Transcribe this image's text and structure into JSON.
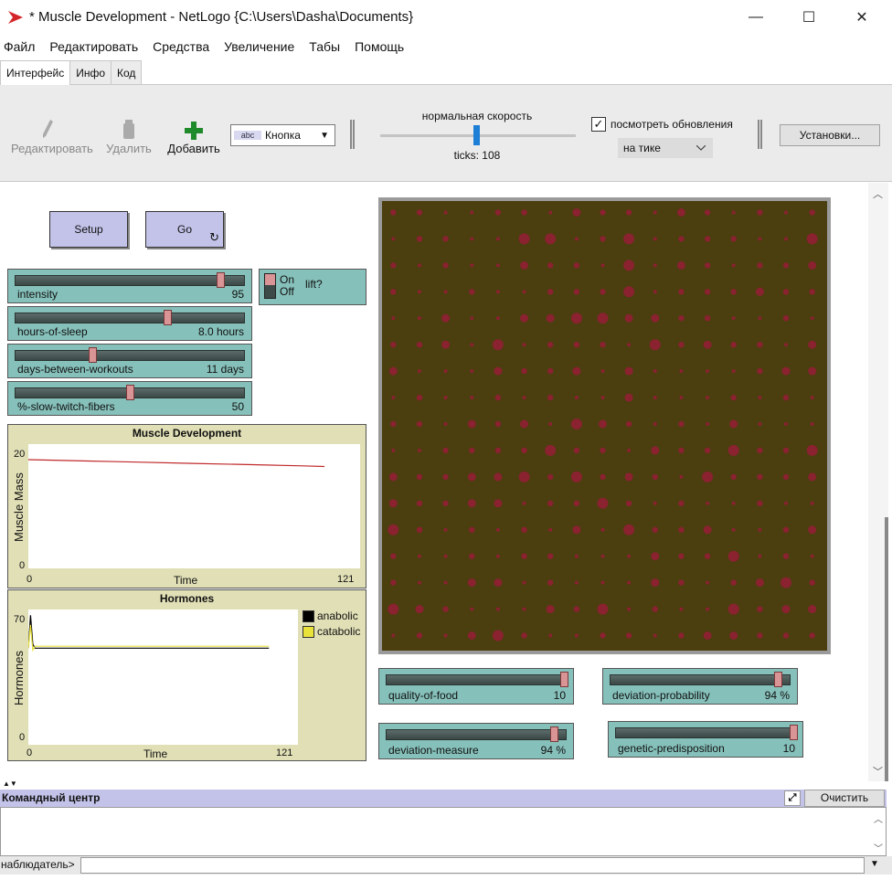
{
  "window": {
    "title": "* Muscle Development - NetLogo {C:\\Users\\Dasha\\Documents}",
    "minimize": "—",
    "maximize": "☐",
    "close": "✕"
  },
  "menu": [
    "Файл",
    "Редактировать",
    "Средства",
    "Увеличение",
    "Табы",
    "Помощь"
  ],
  "tabs": [
    "Интерфейс",
    "Инфо",
    "Код"
  ],
  "toolbar": {
    "edit_label": "Редактировать",
    "delete_label": "Удалить",
    "add_label": "Добавить",
    "widget_type": "Кнопка",
    "widget_icon_text": "abc",
    "speed_label": "нормальная скорость",
    "speed_fraction": 0.5,
    "ticks_text": "ticks: 108",
    "view_updates_label": "посмотреть обновления",
    "view_updates_checked": true,
    "check_mark": "✓",
    "update_mode": "на тике",
    "settings_label": "Установки..."
  },
  "buttons": {
    "setup": "Setup",
    "go": "Go"
  },
  "switch": {
    "on": "On",
    "off": "Off",
    "name": "lift?",
    "state": "off"
  },
  "sliders": {
    "intensity": {
      "name": "intensity",
      "value": "95",
      "fraction": 0.95
    },
    "sleep": {
      "name": "hours-of-sleep",
      "value": "8.0 hours",
      "fraction": 0.67
    },
    "days": {
      "name": "days-between-workouts",
      "value": "11 days",
      "fraction": 0.33
    },
    "slow": {
      "name": "%-slow-twitch-fibers",
      "value": "50",
      "fraction": 0.5
    },
    "food": {
      "name": "quality-of-food",
      "value": "10",
      "fraction": 1.0
    },
    "devprob": {
      "name": "deviation-probability",
      "value": "94 %",
      "fraction": 0.94
    },
    "devmeasure": {
      "name": "deviation-measure",
      "value": "94 %",
      "fraction": 0.94
    },
    "genetic": {
      "name": "genetic-predisposition",
      "value": "10",
      "fraction": 1.0
    }
  },
  "plots": {
    "muscle": {
      "title": "Muscle Development",
      "ylabel": "Muscle Mass",
      "xlabel": "Time",
      "ymax": "20",
      "ymin": "0",
      "xmin": "0",
      "xmax": "121"
    },
    "hormones": {
      "title": "Hormones",
      "ylabel": "Hormones",
      "xlabel": "Time",
      "ymax": "70",
      "ymin": "0",
      "xmin": "0",
      "xmax": "121",
      "legend": [
        {
          "name": "anabolic",
          "color": "#000000"
        },
        {
          "name": "catabolic",
          "color": "#e8e23a"
        }
      ]
    }
  },
  "chart_data": [
    {
      "type": "line",
      "title": "Muscle Development",
      "xlabel": "Time",
      "ylabel": "Muscle Mass",
      "xlim": [
        0,
        121
      ],
      "ylim": [
        0,
        20
      ],
      "series": [
        {
          "color": "#c0282a",
          "x": [
            0,
            20,
            40,
            60,
            80,
            100,
            108
          ],
          "y": [
            17.5,
            17.3,
            17.1,
            16.9,
            16.7,
            16.5,
            16.4
          ]
        }
      ]
    },
    {
      "type": "line",
      "title": "Hormones",
      "xlabel": "Time",
      "ylabel": "Hormones",
      "xlim": [
        0,
        121
      ],
      "ylim": [
        0,
        70
      ],
      "legend": "right",
      "series": [
        {
          "name": "anabolic",
          "color": "#000000",
          "x": [
            0,
            1,
            2,
            3,
            4,
            108
          ],
          "y": [
            50,
            67,
            52,
            50,
            50,
            50
          ]
        },
        {
          "name": "catabolic",
          "color": "#e8e23a",
          "x": [
            0,
            1,
            2,
            3,
            108
          ],
          "y": [
            50,
            62,
            49,
            51,
            51
          ]
        }
      ]
    }
  ],
  "command_center": {
    "title": "Командный центр",
    "clear_label": "Очистить",
    "prompt": "наблюдатель>",
    "input_value": ""
  },
  "colors": {
    "button_bg": "#c3c3ea",
    "slider_bg": "#86c0ba",
    "plot_bg": "#e0dfb6",
    "world_bg": "#4b3e0f",
    "turtle": "#8a2230"
  }
}
